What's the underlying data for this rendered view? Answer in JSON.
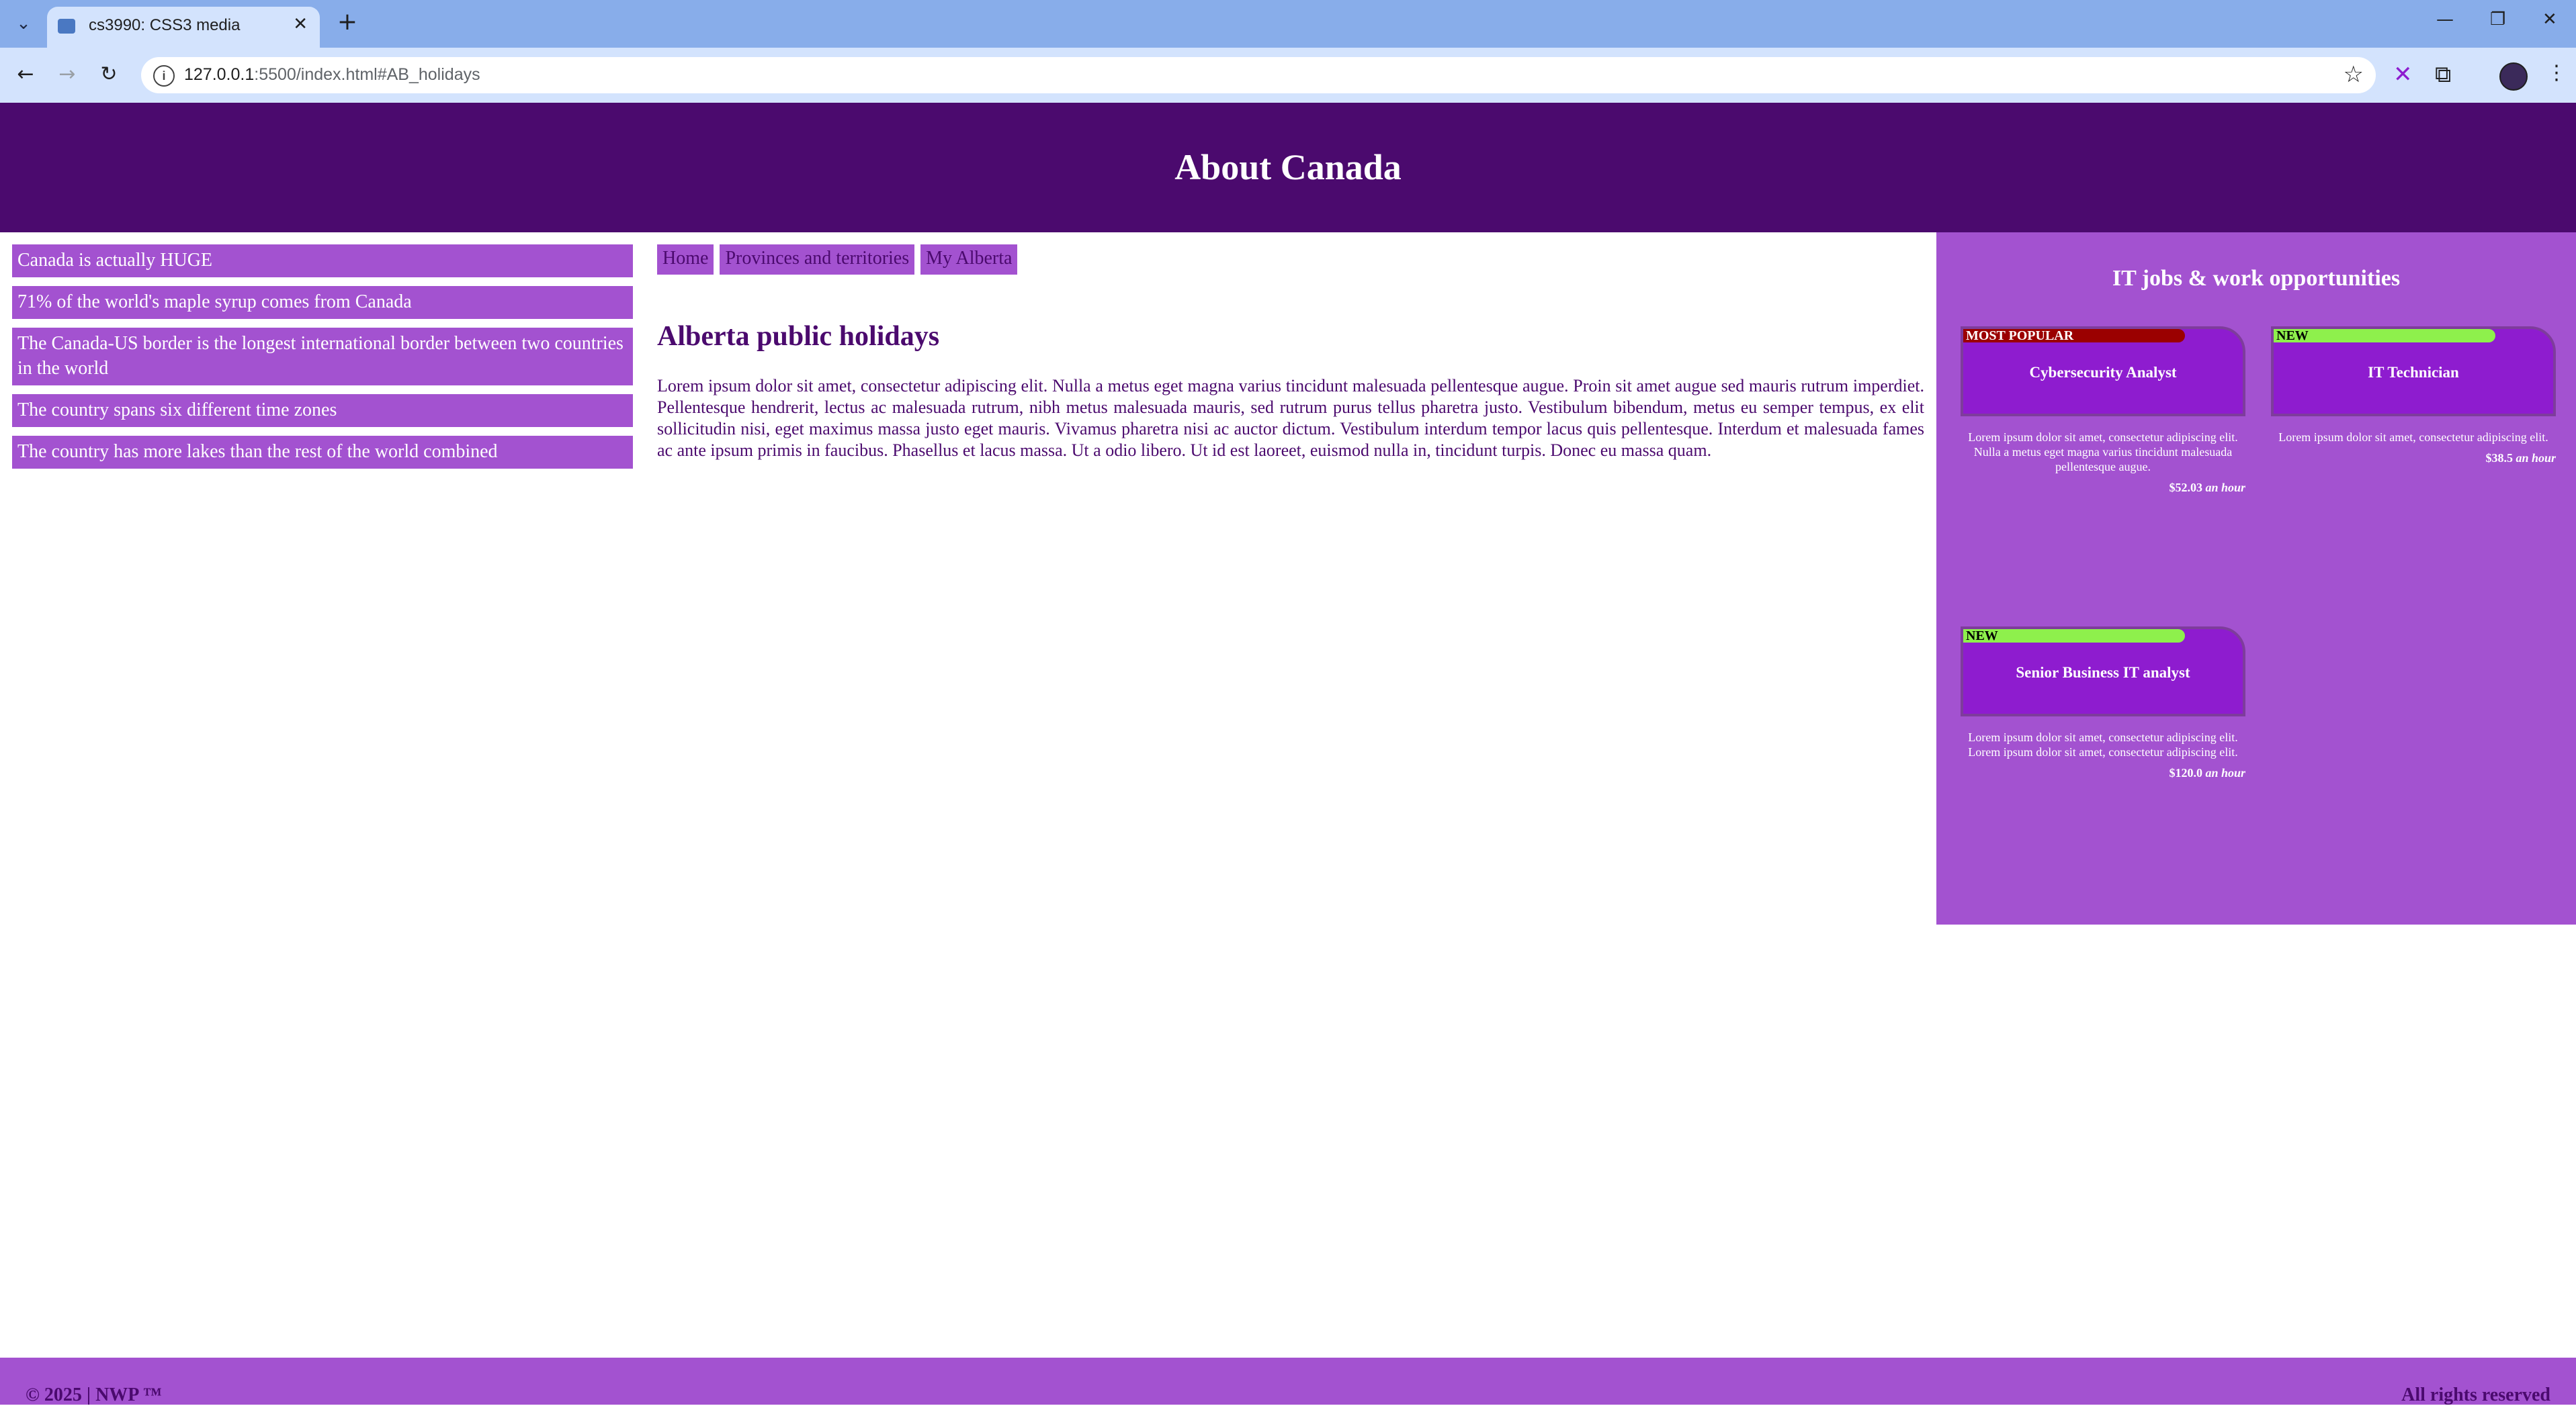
{
  "browser": {
    "tab_title": "cs3990: CSS3 media",
    "url_host": "127.0.0.1",
    "url_rest": ":5500/index.html#AB_holidays"
  },
  "header": {
    "title": "About Canada"
  },
  "left_nav": [
    "Canada is actually HUGE",
    "71% of the world's maple syrup comes from Canada",
    "The Canada-US border is the longest international border between two countries in the world",
    "The country spans six different time zones",
    "The country has more lakes than the rest of the world combined"
  ],
  "breadcrumbs": [
    "Home",
    "Provinces and territories",
    "My Alberta"
  ],
  "main": {
    "heading": "Alberta public holidays",
    "body": "Lorem ipsum dolor sit amet, consectetur adipiscing elit. Nulla a metus eget magna varius tincidunt malesuada pellentesque augue. Proin sit amet augue sed mauris rutrum imperdiet. Pellentesque hendrerit, lectus ac malesuada rutrum, nibh metus malesuada mauris, sed rutrum purus tellus pharetra justo. Vestibulum bibendum, metus eu semper tempus, ex elit sollicitudin nisi, eget maximus massa justo eget mauris. Vivamus pharetra nisi ac auctor dictum. Vestibulum interdum tempor lacus quis pellentesque. Interdum et malesuada fames ac ante ipsum primis in faucibus. Phasellus et lacus massa. Ut a odio libero. Ut id est laoreet, euismod nulla in, tincidunt turpis. Donec eu massa quam."
  },
  "jobs": {
    "title": "IT jobs & work opportunities",
    "items": [
      {
        "badge": "MOST POPULAR",
        "name": "Cybersecurity Analyst",
        "desc": "Lorem ipsum dolor sit amet, consectetur adipiscing elit. Nulla a metus eget magna varius tincidunt malesuada pellentesque augue.",
        "pay": "$52.03",
        "unit": "an hour"
      },
      {
        "badge": "NEW",
        "name": "IT Technician",
        "desc": "Lorem ipsum dolor sit amet, consectetur adipiscing elit.",
        "pay": "$38.5",
        "unit": "an hour"
      },
      {
        "badge": "NEW",
        "name": "Senior Business IT analyst",
        "desc": "Lorem ipsum dolor sit amet, consectetur adipiscing elit. Lorem ipsum dolor sit amet, consectetur adipiscing elit.",
        "pay": "$120.0",
        "unit": "an hour"
      }
    ]
  },
  "footer": {
    "left": "© 2025 | NWP ™",
    "right": "All rights reserved"
  },
  "colors": {
    "header_bg": "#4b0a6e",
    "accent": "#a352d0",
    "card_bg": "#8e1ccf",
    "badge_popular": "#9b0000",
    "badge_new": "#8ef04c"
  }
}
